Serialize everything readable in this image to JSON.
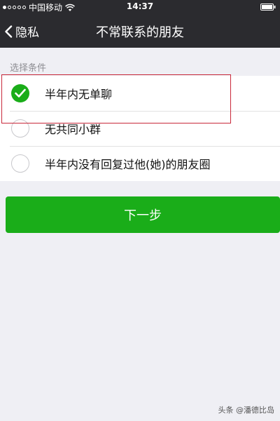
{
  "status_bar": {
    "carrier": "中国移动",
    "time": "14:37",
    "signal_dots_filled": 1,
    "signal_dots_total": 5
  },
  "nav": {
    "back_label": "隐私",
    "title": "不常联系的朋友"
  },
  "section": {
    "label": "选择条件"
  },
  "options": [
    {
      "label": "半年内无单聊",
      "checked": true
    },
    {
      "label": "无共同小群",
      "checked": false
    },
    {
      "label": "半年内没有回复过他(她)的朋友圈",
      "checked": false
    }
  ],
  "next_button": {
    "label": "下一步"
  },
  "watermark": "头条 @潘德比岛",
  "colors": {
    "accent": "#1aad19",
    "nav_bg": "#2b2b2f",
    "page_bg": "#efeff4",
    "highlight": "#c8283a"
  }
}
